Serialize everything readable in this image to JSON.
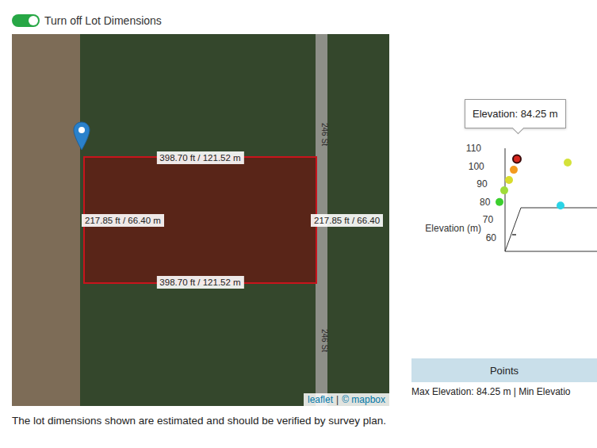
{
  "toggle": {
    "label": "Turn off Lot Dimensions",
    "on": true
  },
  "map": {
    "roads": [
      {
        "label": "246 St"
      },
      {
        "label": "246 St"
      }
    ],
    "lot": {
      "dimensions": {
        "top": "398.70 ft / 121.52 m",
        "bottom": "398.70 ft / 121.52 m",
        "left": "217.85 ft / 66.40 m",
        "right": "217.85 ft / 66.40"
      }
    },
    "attribution": {
      "leaflet": "leaflet",
      "separator": "|",
      "mapbox": "© mapbox"
    }
  },
  "note": "The lot dimensions shown are estimated and should be verified by survey plan.",
  "chart": {
    "tooltip": "Elevation: 84.25 m",
    "axis": {
      "label": "Elevation (m)",
      "ticks": [
        "110",
        "100",
        "90",
        "80",
        "70",
        "60"
      ]
    },
    "points": [
      {
        "elevation": 104,
        "distance": 11.5,
        "color": "#d7261e",
        "highlighted": true
      },
      {
        "elevation": 98,
        "distance": 9.5,
        "color": "#f39a1e",
        "highlighted": false
      },
      {
        "elevation": 92.3,
        "distance": 6.5,
        "color": "#d9dc2c",
        "highlighted": false
      },
      {
        "elevation": 86.5,
        "distance": 3.5,
        "color": "#9fdc3a",
        "highlighted": false
      },
      {
        "elevation": 80,
        "distance": 0.5,
        "color": "#3ccf2e",
        "highlighted": false
      },
      {
        "elevation": 102,
        "distance": 43.5,
        "color": "#d4e23a",
        "highlighted": false
      },
      {
        "elevation": 78,
        "distance": 39,
        "color": "#2ad3e6",
        "highlighted": false
      }
    ]
  },
  "button": "Points",
  "summary": "Max Elevation: 84.25 m | Min Elevatio"
}
